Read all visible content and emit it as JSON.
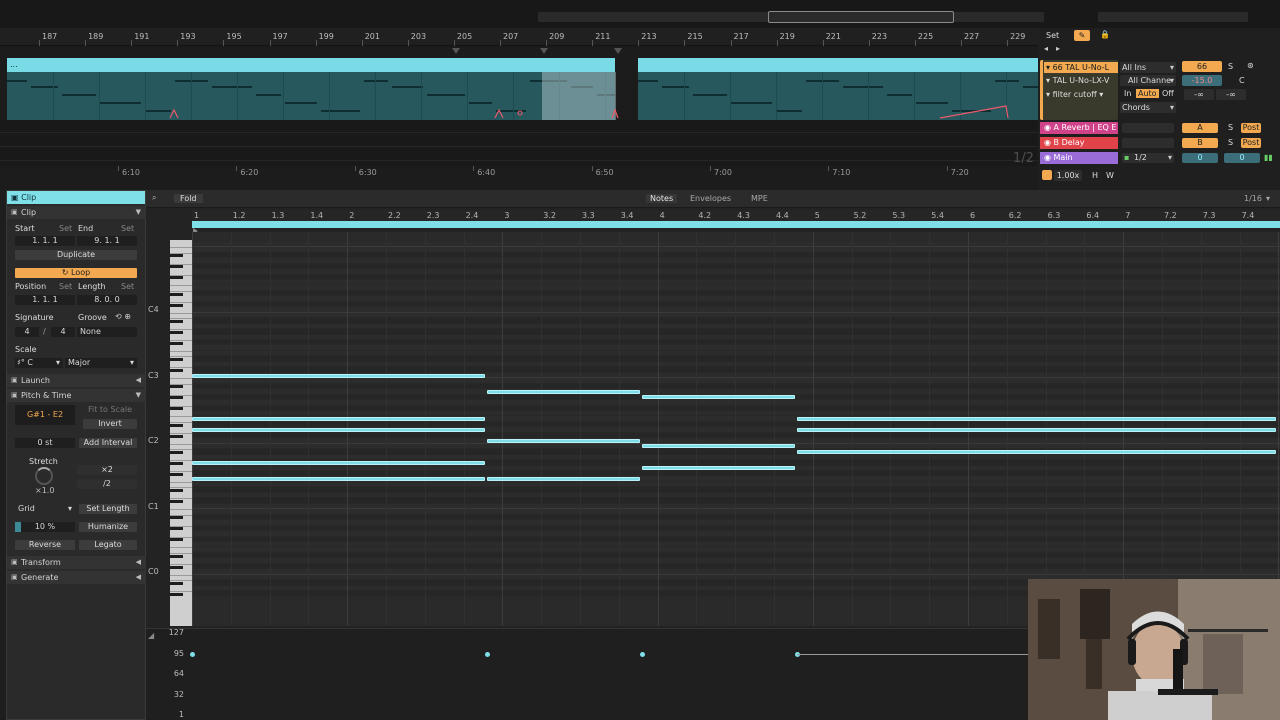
{
  "colors": {
    "accent": "#7fe0ea",
    "note": "#7ddde6",
    "clip_body": "#27585e",
    "orange": "#f2a950",
    "red_track": "#e0434a",
    "pink_track": "#d0438b",
    "purple_track": "#9a6cd8"
  },
  "arrangement": {
    "bar_numbers": [
      "187",
      "189",
      "191",
      "193",
      "195",
      "197",
      "199",
      "201",
      "203",
      "205",
      "207",
      "209",
      "211",
      "213",
      "215",
      "217",
      "219",
      "221",
      "223",
      "225",
      "227",
      "229"
    ],
    "clip_name": "...",
    "time_labels": [
      "6:10",
      "6:20",
      "6:30",
      "6:40",
      "6:50",
      "7:00",
      "7:10",
      "7:20"
    ],
    "ratio": "1/2"
  },
  "mixer": {
    "set_label": "Set",
    "track_name": "66 TAL U-No-L",
    "device_name": "TAL U-No-LX-V",
    "param_name": "filter cutoff",
    "input_type": "All Ins",
    "input_channel": "All Channe",
    "monitor_in": "In",
    "monitor_auto": "Auto",
    "monitor_off": "Off",
    "chords": "Chords",
    "track_number": "66",
    "solo": "S",
    "volume": "-15.0",
    "pan": "C",
    "send_a": "-∞",
    "send_b": "-∞",
    "return_a": "A Reverb | EQ E",
    "return_b": "B Delay",
    "main": "Main",
    "return_a_letter": "A",
    "return_b_letter": "B",
    "post": "Post",
    "main_ratio": "1/2",
    "main_val1": "0",
    "main_val2": "0",
    "tempo_factor": "1.00x",
    "h_btn": "H",
    "w_btn": "W"
  },
  "clip_panel": {
    "header": "Clip",
    "section_clip": "Clip",
    "start_label": "Start",
    "set_label": "Set",
    "end_label": "End",
    "start_value": "1.  1.  1",
    "end_value": "9.  1.  1",
    "duplicate": "Duplicate",
    "loop": "Loop",
    "position_label": "Position",
    "length_label": "Length",
    "position_value": "1.  1.  1",
    "length_value": "8.  0.  0",
    "signature_label": "Signature",
    "groove_label": "Groove",
    "sig_num": "4",
    "sig_slash": "/",
    "sig_den": "4",
    "groove_value": "None",
    "scale_label": "Scale",
    "scale_root": "C",
    "scale_mode": "Major",
    "launch": "Launch",
    "pitch_time": "Pitch & Time",
    "range": "G#1 - E2",
    "fit_to_scale": "Fit to Scale",
    "invert": "Invert",
    "transpose": "0 st",
    "add_interval": "Add Interval",
    "stretch_label": "Stretch",
    "x2": "×2",
    "div2": "/2",
    "stretch_value": "×1.0",
    "grid": "Grid",
    "set_length": "Set Length",
    "humanize_pct": "10 %",
    "humanize": "Humanize",
    "reverse": "Reverse",
    "legato": "Legato",
    "transform": "Transform",
    "generate": "Generate"
  },
  "editor": {
    "fold": "Fold",
    "tab_notes": "Notes",
    "tab_envelopes": "Envelopes",
    "tab_mpe": "MPE",
    "grid_quant": "1/16",
    "ruler": [
      "1",
      "1.2",
      "1.3",
      "1.4",
      "2",
      "2.2",
      "2.3",
      "2.4",
      "3",
      "3.2",
      "3.3",
      "3.4",
      "4",
      "4.2",
      "4.3",
      "4.4",
      "5",
      "5.2",
      "5.3",
      "5.4",
      "6",
      "6.2",
      "6.3",
      "6.4",
      "7",
      "7.2",
      "7.3",
      "7.4"
    ],
    "octaves": [
      "C4",
      "C3",
      "C2",
      "C1",
      "C0"
    ],
    "velocity_labels": [
      "127",
      "95",
      "64",
      "32",
      "1"
    ],
    "notes": [
      {
        "pitch": "G#1",
        "start": 1.0,
        "end": 2.9
      },
      {
        "pitch": "D2",
        "start": 1.0,
        "end": 2.9
      },
      {
        "pitch": "E2",
        "start": 1.0,
        "end": 2.9
      },
      {
        "pitch": "C3",
        "start": 1.0,
        "end": 2.9
      },
      {
        "pitch": "F1",
        "start": 1.0,
        "end": 2.9
      },
      {
        "pitch": "F1",
        "start": 2.9,
        "end": 3.9
      },
      {
        "pitch": "C2",
        "start": 2.9,
        "end": 3.9
      },
      {
        "pitch": "A2",
        "start": 2.9,
        "end": 3.9
      },
      {
        "pitch": "G1",
        "start": 3.9,
        "end": 4.9
      },
      {
        "pitch": "B1",
        "start": 3.9,
        "end": 4.9
      },
      {
        "pitch": "G#2",
        "start": 3.9,
        "end": 4.9
      },
      {
        "pitch": "D2",
        "start": 4.9,
        "end": 8.0
      },
      {
        "pitch": "E2",
        "start": 4.9,
        "end": 8.0
      },
      {
        "pitch": "A#1",
        "start": 4.9,
        "end": 8.0
      }
    ],
    "velocities": [
      95,
      95,
      95,
      95
    ]
  }
}
